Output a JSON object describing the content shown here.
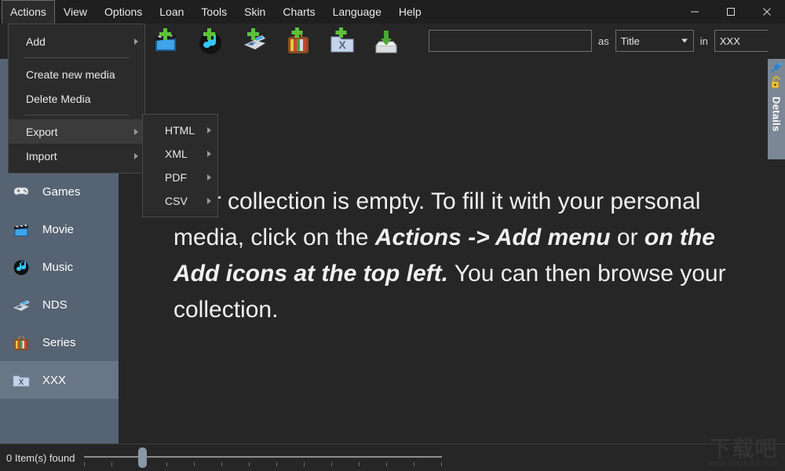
{
  "window": {
    "controls": [
      {
        "name": "minimize",
        "glyph": "—"
      },
      {
        "name": "maximize",
        "glyph": "□"
      },
      {
        "name": "close",
        "glyph": "✕"
      }
    ]
  },
  "menubar": {
    "items": [
      {
        "label": "Actions",
        "active": true
      },
      {
        "label": "View",
        "active": false
      },
      {
        "label": "Options",
        "active": false
      },
      {
        "label": "Loan",
        "active": false
      },
      {
        "label": "Tools",
        "active": false
      },
      {
        "label": "Skin",
        "active": false
      },
      {
        "label": "Charts",
        "active": false
      },
      {
        "label": "Language",
        "active": false
      },
      {
        "label": "Help",
        "active": false
      }
    ]
  },
  "actions_menu": {
    "items": [
      {
        "label": "Add",
        "submenu": true,
        "hover": false,
        "separator_after": true
      },
      {
        "label": "Create new media",
        "submenu": false,
        "hover": false,
        "separator_after": false
      },
      {
        "label": "Delete Media",
        "submenu": false,
        "hover": false,
        "separator_after": true
      },
      {
        "label": "Export",
        "submenu": true,
        "hover": true,
        "separator_after": false
      },
      {
        "label": "Import",
        "submenu": true,
        "hover": false,
        "separator_after": false
      }
    ]
  },
  "export_submenu": {
    "items": [
      {
        "label": "HTML",
        "submenu": true
      },
      {
        "label": "XML",
        "submenu": true
      },
      {
        "label": "PDF",
        "submenu": true
      },
      {
        "label": "CSV",
        "submenu": true
      }
    ]
  },
  "toolbar": {
    "icons": [
      {
        "name": "add-movie-icon",
        "title": "Add Movie"
      },
      {
        "name": "add-music-icon",
        "title": "Add Music"
      },
      {
        "name": "add-nds-icon",
        "title": "Add NDS"
      },
      {
        "name": "add-series-icon",
        "title": "Add Series"
      },
      {
        "name": "add-xxx-icon",
        "title": "Add XXX"
      },
      {
        "name": "import-icon",
        "title": "Import"
      }
    ],
    "search_value": "",
    "search_placeholder": "",
    "as_label": "as",
    "search_field_selected": "Title",
    "search_field_options": [
      "Title"
    ],
    "in_label": "in",
    "in_value": "XXX"
  },
  "sidebar": {
    "items": [
      {
        "label": "Games",
        "icon": "gamepad-icon",
        "selected": false
      },
      {
        "label": "Movie",
        "icon": "clapperboard-icon",
        "selected": false
      },
      {
        "label": "Music",
        "icon": "music-disc-icon",
        "selected": false
      },
      {
        "label": "NDS",
        "icon": "nds-console-icon",
        "selected": false
      },
      {
        "label": "Series",
        "icon": "television-icon",
        "selected": false
      },
      {
        "label": "XXX",
        "icon": "x-folder-icon",
        "selected": true
      }
    ]
  },
  "content": {
    "empty_message_parts": [
      {
        "text": "Your collection is empty. To fill it with your personal media, click on the ",
        "bold": false
      },
      {
        "text": "Actions -> Add menu",
        "bold": true
      },
      {
        "text": " or ",
        "bold": false
      },
      {
        "text": "on the Add icons at the top left.",
        "bold": true
      },
      {
        "text": " You can then browse your collection.",
        "bold": false
      }
    ]
  },
  "details_panel": {
    "label": "Details",
    "pin_icon": "pin-icon",
    "lock_icon": "lock-icon"
  },
  "statusbar": {
    "item_count_text": "0 Item(s) found",
    "zoom_slider_position_percent": 15
  },
  "watermark": {
    "chinese": "下载吧",
    "url": "www.xiazaiba.com"
  },
  "colors": {
    "app_background": "#262626",
    "titlebar": "#1f1f1f",
    "sidebar": "#566373",
    "sidebar_selected": "#697686",
    "details_strip": "#7b8795",
    "menu_background": "#2b2b2b",
    "menu_hover": "#3b3b3b",
    "text_primary": "#eaeaea"
  }
}
